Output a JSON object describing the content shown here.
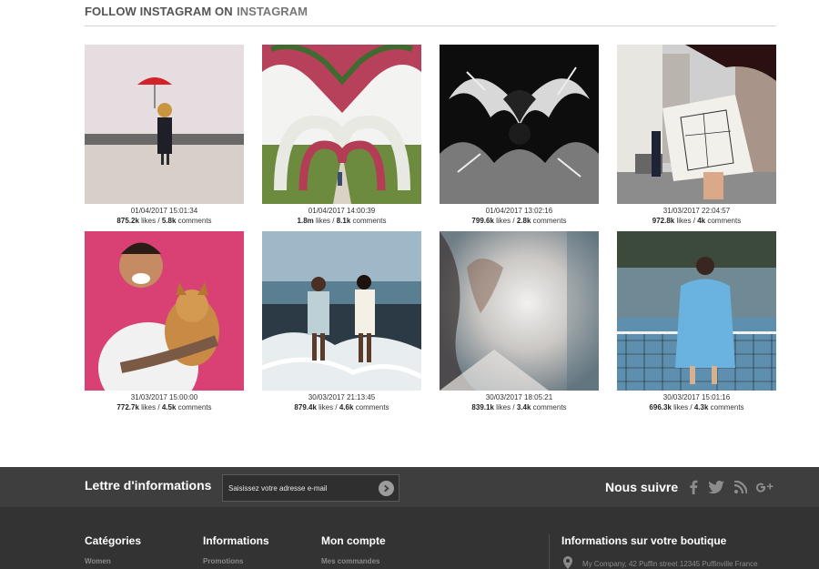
{
  "instagram": {
    "title_prefix": "FOLLOW INSTAGRAM ON",
    "title_brand": "INSTAGRAM",
    "posts": [
      {
        "date": "01/04/2017 15:01:34",
        "likes": "875.2k",
        "comments": "5.8k"
      },
      {
        "date": "01/04/2017 14:00:39",
        "likes": "1.8m",
        "comments": "8.1k"
      },
      {
        "date": "01/04/2017 13:02:16",
        "likes": "799.6k",
        "comments": "2.8k"
      },
      {
        "date": "31/03/2017 22:04:57",
        "likes": "972.8k",
        "comments": "4k"
      },
      {
        "date": "31/03/2017 15:00:00",
        "likes": "772.7k",
        "comments": "4.5k"
      },
      {
        "date": "30/03/2017 21:13:45",
        "likes": "879.4k",
        "comments": "4.6k"
      },
      {
        "date": "30/03/2017 18:05:21",
        "likes": "839.1k",
        "comments": "3.4k"
      },
      {
        "date": "30/03/2017 15:01:16",
        "likes": "696.3k",
        "comments": "4.3k"
      }
    ],
    "likes_word": "likes",
    "separator": "/",
    "comments_word": "comments"
  },
  "newsletter": {
    "title": "Lettre d'informations",
    "placeholder": "Saisissez votre adresse e-mail",
    "follow_title": "Nous suivre",
    "social_icons": [
      "facebook-icon",
      "twitter-icon",
      "rss-icon",
      "google-plus-icon"
    ]
  },
  "footer": {
    "categories": {
      "title": "Catégories",
      "first_link": "Women"
    },
    "information": {
      "title": "Informations",
      "first_link": "Promotions"
    },
    "account": {
      "title": "Mon compte",
      "first_link": "Mes commandes"
    },
    "store": {
      "title": "Informations sur votre boutique",
      "address": "My Company, 42 Puffin street 12345 Puffinville France"
    }
  },
  "colors": {
    "newsletter_bg": "#3e3e3e",
    "footer_bg": "#333333",
    "muted_text": "#8a8a8a"
  }
}
